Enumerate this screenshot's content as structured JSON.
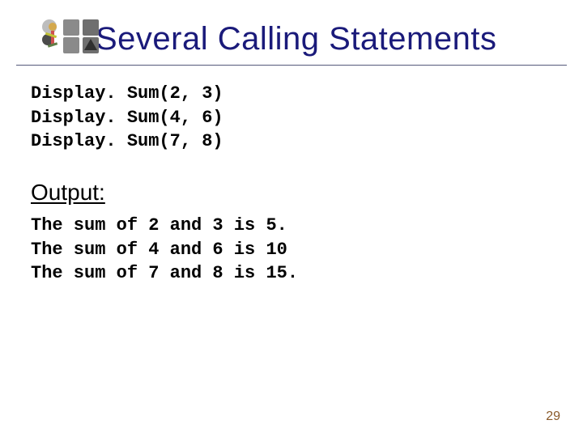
{
  "title": "Several Calling Statements",
  "code_lines": [
    "Display. Sum(2, 3)",
    "Display. Sum(4, 6)",
    "Display. Sum(7, 8)"
  ],
  "output_heading": "Output:",
  "output_lines": [
    "The sum of 2 and 3 is 5.",
    "The sum of 4 and 6 is 10",
    "The sum of 7 and 8 is 15."
  ],
  "page_number": "29"
}
